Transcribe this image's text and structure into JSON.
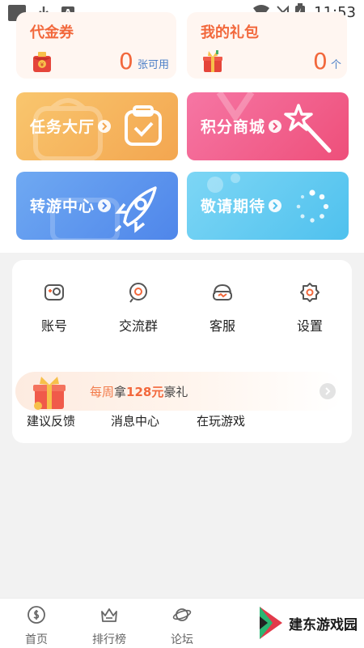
{
  "statusbar": {
    "time": "11:53",
    "a_glyph": "A"
  },
  "cards": {
    "voucher": {
      "title": "代金券",
      "count": "0",
      "unit": "张可用"
    },
    "gift": {
      "title": "我的礼包",
      "count": "0",
      "unit": "个"
    }
  },
  "tiles": [
    {
      "label": "任务大厅",
      "icon": "calendar-check-icon",
      "color": "#f6b45c"
    },
    {
      "label": "积分商城",
      "icon": "magic-wand-icon",
      "color": "#f2628e"
    },
    {
      "label": "转游中心",
      "icon": "rocket-icon",
      "color": "#5b97ee"
    },
    {
      "label": "敬请期待",
      "icon": "loading-icon",
      "color": "#5fc7f0"
    }
  ],
  "grid": [
    {
      "label": "账号",
      "icon": "account-icon"
    },
    {
      "label": "交流群",
      "icon": "group-chat-icon"
    },
    {
      "label": "客服",
      "icon": "customer-service-icon"
    },
    {
      "label": "设置",
      "icon": "settings-icon"
    }
  ],
  "banner": {
    "prefix": "每周",
    "verb": "拿",
    "amount": "128元",
    "suffix": "豪礼"
  },
  "row3": [
    {
      "label": "建议反馈"
    },
    {
      "label": "消息中心"
    },
    {
      "label": "在玩游戏"
    }
  ],
  "tabs": [
    {
      "label": "首页",
      "icon": "home-coin-icon"
    },
    {
      "label": "排行榜",
      "icon": "crown-icon"
    },
    {
      "label": "论坛",
      "icon": "planet-icon"
    }
  ],
  "watermark": {
    "text": "建东游戏园"
  }
}
